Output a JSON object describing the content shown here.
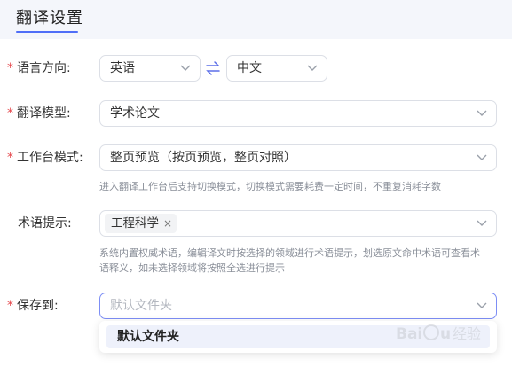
{
  "header": {
    "title": "翻译设置"
  },
  "fields": {
    "direction": {
      "label": "语言方向:",
      "source": "英语",
      "target": "中文"
    },
    "model": {
      "label": "翻译模型:",
      "value": "学术论文"
    },
    "workbench": {
      "label": "工作台模式:",
      "value": "整页预览（按页预览，整页对照）",
      "hint": "进入翻译工作台后支持切换模式，切换模式需要耗费一定时间，不重复消耗字数"
    },
    "terms": {
      "label": "术语提示:",
      "tag": "工程科学",
      "hint_line1": "系统内置权威术语，编辑译文时按选择的领域进行术语提示，划选原文命中术语可查看术",
      "hint_line2": "语释义，如未选择领域将按照全选进行提示"
    },
    "save": {
      "label": "保存到:",
      "placeholder": "默认文件夹",
      "options": [
        "默认文件夹"
      ]
    }
  },
  "required_mark": "*",
  "tag_close": "×",
  "watermark": "Bai du 经验",
  "colors": {
    "accent": "#4f6ef7",
    "required": "#e5484d",
    "hint": "#8a8f99"
  }
}
